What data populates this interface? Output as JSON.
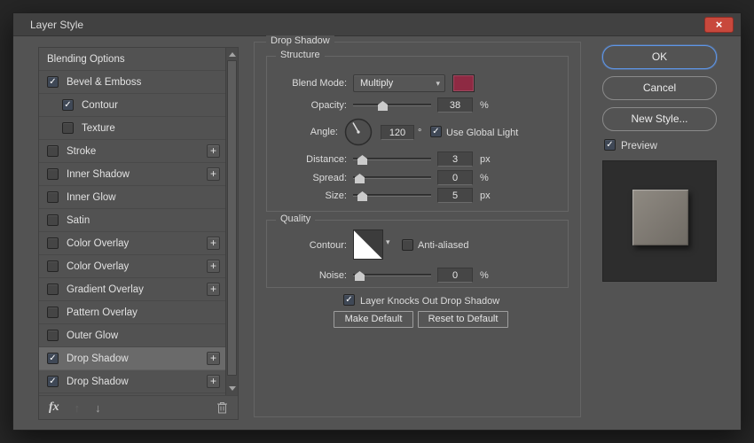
{
  "window": {
    "title": "Layer Style"
  },
  "icons": {
    "close": "×",
    "check": "✓",
    "plus": "+",
    "chevron": "▾",
    "fx": "fx",
    "up": "↑",
    "down": "↓"
  },
  "colors": {
    "swatch": "#8e2a43",
    "ok_focus": "#5e96e8"
  },
  "styles_list": {
    "items": [
      {
        "label": "Blending Options",
        "checkbox": null,
        "indent": false,
        "add": false,
        "selected": false
      },
      {
        "label": "Bevel & Emboss",
        "checkbox": true,
        "indent": false,
        "add": false,
        "selected": false
      },
      {
        "label": "Contour",
        "checkbox": true,
        "indent": true,
        "add": false,
        "selected": false
      },
      {
        "label": "Texture",
        "checkbox": false,
        "indent": true,
        "add": false,
        "selected": false
      },
      {
        "label": "Stroke",
        "checkbox": false,
        "indent": false,
        "add": true,
        "selected": false
      },
      {
        "label": "Inner Shadow",
        "checkbox": false,
        "indent": false,
        "add": true,
        "selected": false
      },
      {
        "label": "Inner Glow",
        "checkbox": false,
        "indent": false,
        "add": false,
        "selected": false
      },
      {
        "label": "Satin",
        "checkbox": false,
        "indent": false,
        "add": false,
        "selected": false
      },
      {
        "label": "Color Overlay",
        "checkbox": false,
        "indent": false,
        "add": true,
        "selected": false
      },
      {
        "label": "Color Overlay",
        "checkbox": false,
        "indent": false,
        "add": true,
        "selected": false
      },
      {
        "label": "Gradient Overlay",
        "checkbox": false,
        "indent": false,
        "add": true,
        "selected": false
      },
      {
        "label": "Pattern Overlay",
        "checkbox": false,
        "indent": false,
        "add": false,
        "selected": false
      },
      {
        "label": "Outer Glow",
        "checkbox": false,
        "indent": false,
        "add": false,
        "selected": false
      },
      {
        "label": "Drop Shadow",
        "checkbox": true,
        "indent": false,
        "add": true,
        "selected": true
      },
      {
        "label": "Drop Shadow",
        "checkbox": true,
        "indent": false,
        "add": true,
        "selected": false
      }
    ]
  },
  "panel": {
    "title": "Drop Shadow",
    "structure": {
      "legend": "Structure",
      "blend": {
        "label": "Blend Mode:",
        "value": "Multiply"
      },
      "opacity": {
        "label": "Opacity:",
        "value": "38",
        "unit": "%",
        "fraction": 0.36
      },
      "angle": {
        "label": "Angle:",
        "value": "120",
        "unit": "°",
        "global_light": "Use Global Light"
      },
      "distance": {
        "label": "Distance:",
        "value": "3",
        "unit": "px",
        "fraction": 0.07
      },
      "spread": {
        "label": "Spread:",
        "value": "0",
        "unit": "%",
        "fraction": 0.02
      },
      "size": {
        "label": "Size:",
        "value": "5",
        "unit": "px",
        "fraction": 0.06
      }
    },
    "quality": {
      "legend": "Quality",
      "contour_label": "Contour:",
      "anti_aliased": "Anti-aliased",
      "noise": {
        "label": "Noise:",
        "value": "0",
        "unit": "%",
        "fraction": 0.02
      }
    },
    "knockout": "Layer Knocks Out Drop Shadow",
    "make_default": "Make Default",
    "reset_default": "Reset to Default"
  },
  "actions": {
    "ok": "OK",
    "cancel": "Cancel",
    "new_style": "New Style...",
    "preview": "Preview"
  }
}
